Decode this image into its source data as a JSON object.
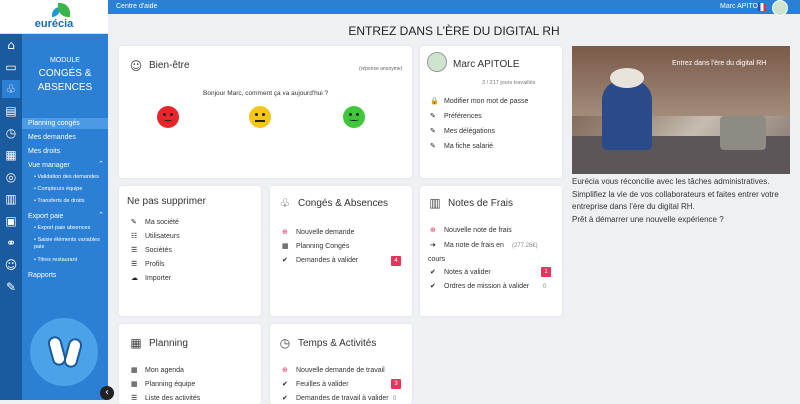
{
  "app": {
    "logo": "eurécia",
    "module_kicker": "MODULE",
    "module_title_1": "CONGÉS &",
    "module_title_2": "ABSENCES"
  },
  "sidebar": {
    "items": [
      {
        "label": "Planning congés"
      },
      {
        "label": "Mes demandes"
      },
      {
        "label": "Mes droits"
      },
      {
        "label": "Vue manager"
      },
      {
        "label": "Validation des demandes"
      },
      {
        "label": "Compteurs équipe"
      },
      {
        "label": "Transferts de droits"
      },
      {
        "label": "Export paie"
      },
      {
        "label": "Export paie absences"
      },
      {
        "label": "Saisie éléments variables paie"
      },
      {
        "label": "Titres restaurant"
      },
      {
        "label": "Rapports"
      }
    ],
    "collapse_glyph": "‹"
  },
  "topbar": {
    "help": "Centre d'aide",
    "user": "Marc APITOLE"
  },
  "page": {
    "title": "ENTREZ DANS L’ÈRE DU DIGITAL RH"
  },
  "wellbeing": {
    "title": "Bien-être",
    "anonymous": "(réponse anonyme)",
    "question": "Bonjour Marc, comment ça va aujourd'hui ?",
    "colors": {
      "sad": "#e8252a",
      "neutral": "#f5c518",
      "happy": "#3fc63a"
    }
  },
  "profile": {
    "name": "Marc APITOLE",
    "days": "3 / 217 jours travaillés",
    "links": [
      {
        "label": "Modifier mon mot de passe",
        "icon": "lock-icon"
      },
      {
        "label": "Préférences",
        "icon": "pencil-icon"
      },
      {
        "label": "Mes délégations",
        "icon": "pencil-icon"
      },
      {
        "label": "Ma fiche salarié",
        "icon": "pencil-icon"
      }
    ]
  },
  "keep": {
    "title": "Ne pas supprimer",
    "links": [
      {
        "label": "Ma société",
        "icon": "pencil-icon"
      },
      {
        "label": "Utilisateurs",
        "icon": "users-icon"
      },
      {
        "label": "Sociétés",
        "icon": "list-icon"
      },
      {
        "label": "Profils",
        "icon": "list-icon"
      },
      {
        "label": "Importer",
        "icon": "cloud-upload-icon"
      }
    ]
  },
  "conges": {
    "title": "Congés & Absences",
    "links": [
      {
        "label": "Nouvelle demande",
        "icon": "plus-circle-icon"
      },
      {
        "label": "Planning Congés",
        "icon": "calendar-icon"
      },
      {
        "label": "Demandes à valider",
        "icon": "check-icon",
        "badge": "4"
      }
    ]
  },
  "frais": {
    "title": "Notes de Frais",
    "links": [
      {
        "label": "Nouvelle note de frais",
        "icon": "plus-circle-icon"
      },
      {
        "label": "Ma note de frais en",
        "label2": "cours",
        "icon": "arrow-right-icon",
        "amount": "(277.26€)"
      },
      {
        "label": "Notes à valider",
        "icon": "check-icon",
        "badge": "1"
      },
      {
        "label": "Ordres de mission à valider",
        "icon": "check-icon",
        "count": "0"
      }
    ]
  },
  "planning": {
    "title": "Planning",
    "links": [
      {
        "label": "Mon agenda",
        "icon": "calendar-icon"
      },
      {
        "label": "Planning équipe",
        "icon": "calendar-icon"
      },
      {
        "label": "Liste des activités",
        "icon": "list-icon"
      }
    ]
  },
  "temps": {
    "title": "Temps & Activités",
    "links": [
      {
        "label": "Nouvelle demande de travail",
        "icon": "plus-circle-icon"
      },
      {
        "label": "Feuilles à valider",
        "icon": "check-icon",
        "badge": "3"
      },
      {
        "label": "Demandes de travail à valider",
        "icon": "check-icon",
        "count": "0"
      }
    ]
  },
  "promo": {
    "photo_caption": "Entrez dans l'ère du digital RH",
    "text": "Eurécia vous réconcilie avec les tâches administratives. Simplifiez la vie de vos collaborateurs et faites entrer votre entreprise dans l’ère du digital RH.",
    "text2": "Prêt à démarrer une nouvelle expérience ?"
  },
  "colors": {
    "sidebar": "#2b7fd4",
    "iconbar": "#1a5a9e",
    "badge": "#e8335d",
    "plus": "#e8335d"
  }
}
